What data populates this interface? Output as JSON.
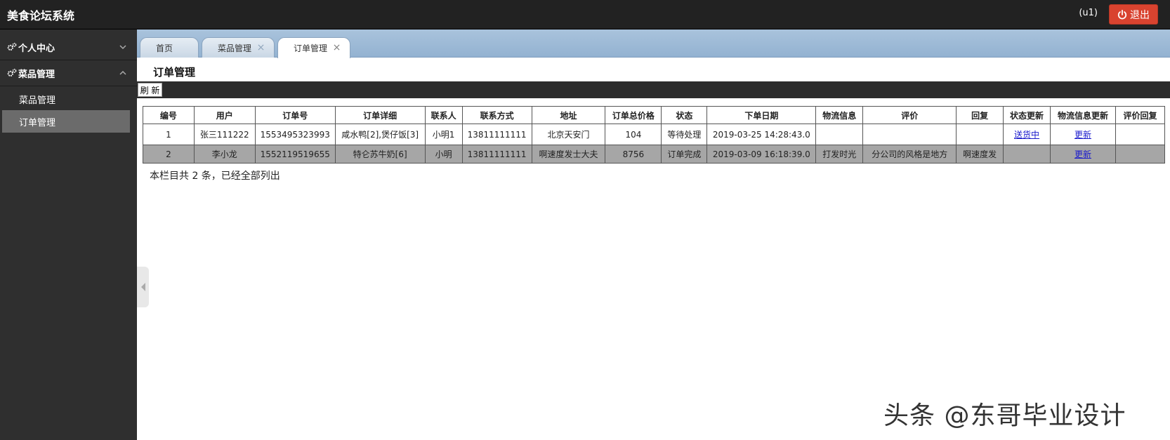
{
  "app": {
    "title": "美食论坛系统",
    "user": "(u1)",
    "logout_label": "退出"
  },
  "sidebar": {
    "sections": [
      {
        "label": "个人中心",
        "state": "collapsed"
      },
      {
        "label": "菜品管理",
        "state": "expanded"
      }
    ],
    "items": [
      {
        "label": "菜品管理",
        "active": false
      },
      {
        "label": "订单管理",
        "active": true
      }
    ]
  },
  "tabs": [
    {
      "label": "首页"
    },
    {
      "label": "菜品管理"
    },
    {
      "label": "订单管理",
      "active": true
    }
  ],
  "page": {
    "title": "订单管理",
    "refresh_label": "刷 新"
  },
  "table": {
    "headers": [
      "编号",
      "用户",
      "订单号",
      "订单详细",
      "联系人",
      "联系方式",
      "地址",
      "订单总价格",
      "状态",
      "下单日期",
      "物流信息",
      "评价",
      "回复",
      "状态更新",
      "物流信息更新",
      "评价回复"
    ],
    "rows": [
      {
        "id": "1",
        "user": "张三111222",
        "order_no": "1553495323993",
        "detail": "咸水鸭[2],煲仔饭[3]",
        "contact": "小明1",
        "phone": "13811111111",
        "address": "北京天安门",
        "total": "104",
        "status": "等待处理",
        "date": "2019-03-25 14:28:43.0",
        "logistics": "",
        "review": "",
        "reply": "",
        "status_update": "送货中",
        "logistics_update": "更新",
        "review_reply": ""
      },
      {
        "id": "2",
        "user": "李小龙",
        "order_no": "1552119519655",
        "detail": "特仑苏牛奶[6]",
        "contact": "小明",
        "phone": "13811111111",
        "address": "啊速度发士大夫",
        "total": "8756",
        "status": "订单完成",
        "date": "2019-03-09 16:18:39.0",
        "logistics": "打发时光",
        "review": "分公司的风格是地方",
        "reply": "啊速度发",
        "status_update": "",
        "logistics_update": "更新",
        "review_reply": ""
      }
    ]
  },
  "summary": "本栏目共 2 条，已经全部列出",
  "watermark": "头条 @东哥毕业设计",
  "colors": {
    "topbar": "#222222",
    "sidebar": "#2f2f2f",
    "logout": "#d9432f",
    "tabbar": "#a9c3dc",
    "row_highlight": "#a6a6a6"
  }
}
